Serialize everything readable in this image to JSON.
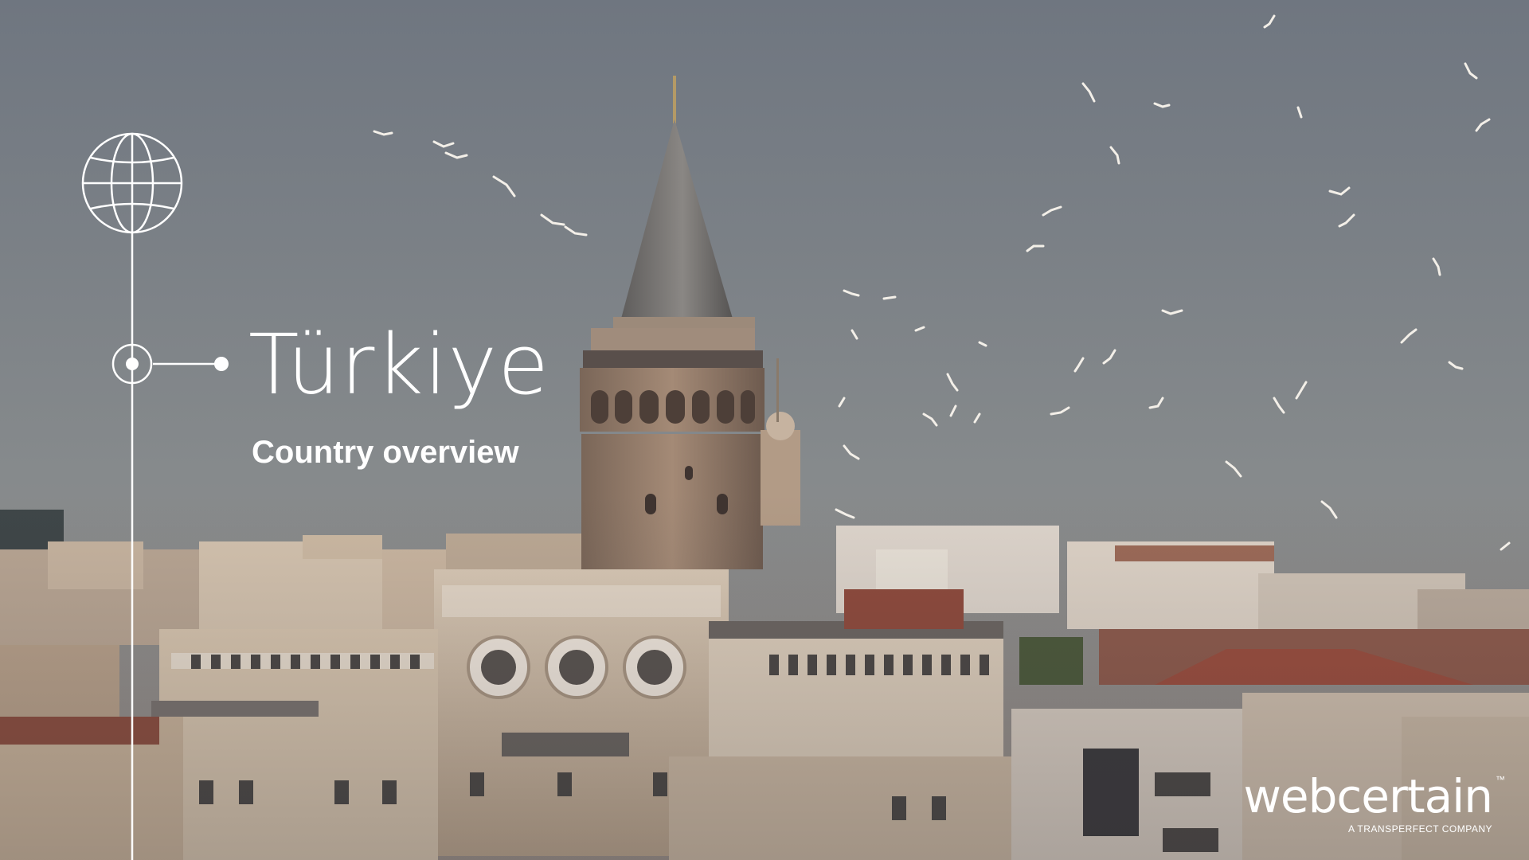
{
  "slide": {
    "title": "Türkiye",
    "subtitle": "Country overview"
  },
  "logo": {
    "wordmark": "webcertain",
    "trademark": "™",
    "tagline": "A TRANSPERFECT COMPANY"
  },
  "icons": {
    "globe": "globe-icon",
    "timeline": "timeline-marker-icon"
  },
  "colors": {
    "sky": "#7f8587",
    "text": "#ffffff",
    "stone": "#b59a7f",
    "roof": "#8a4a38"
  }
}
